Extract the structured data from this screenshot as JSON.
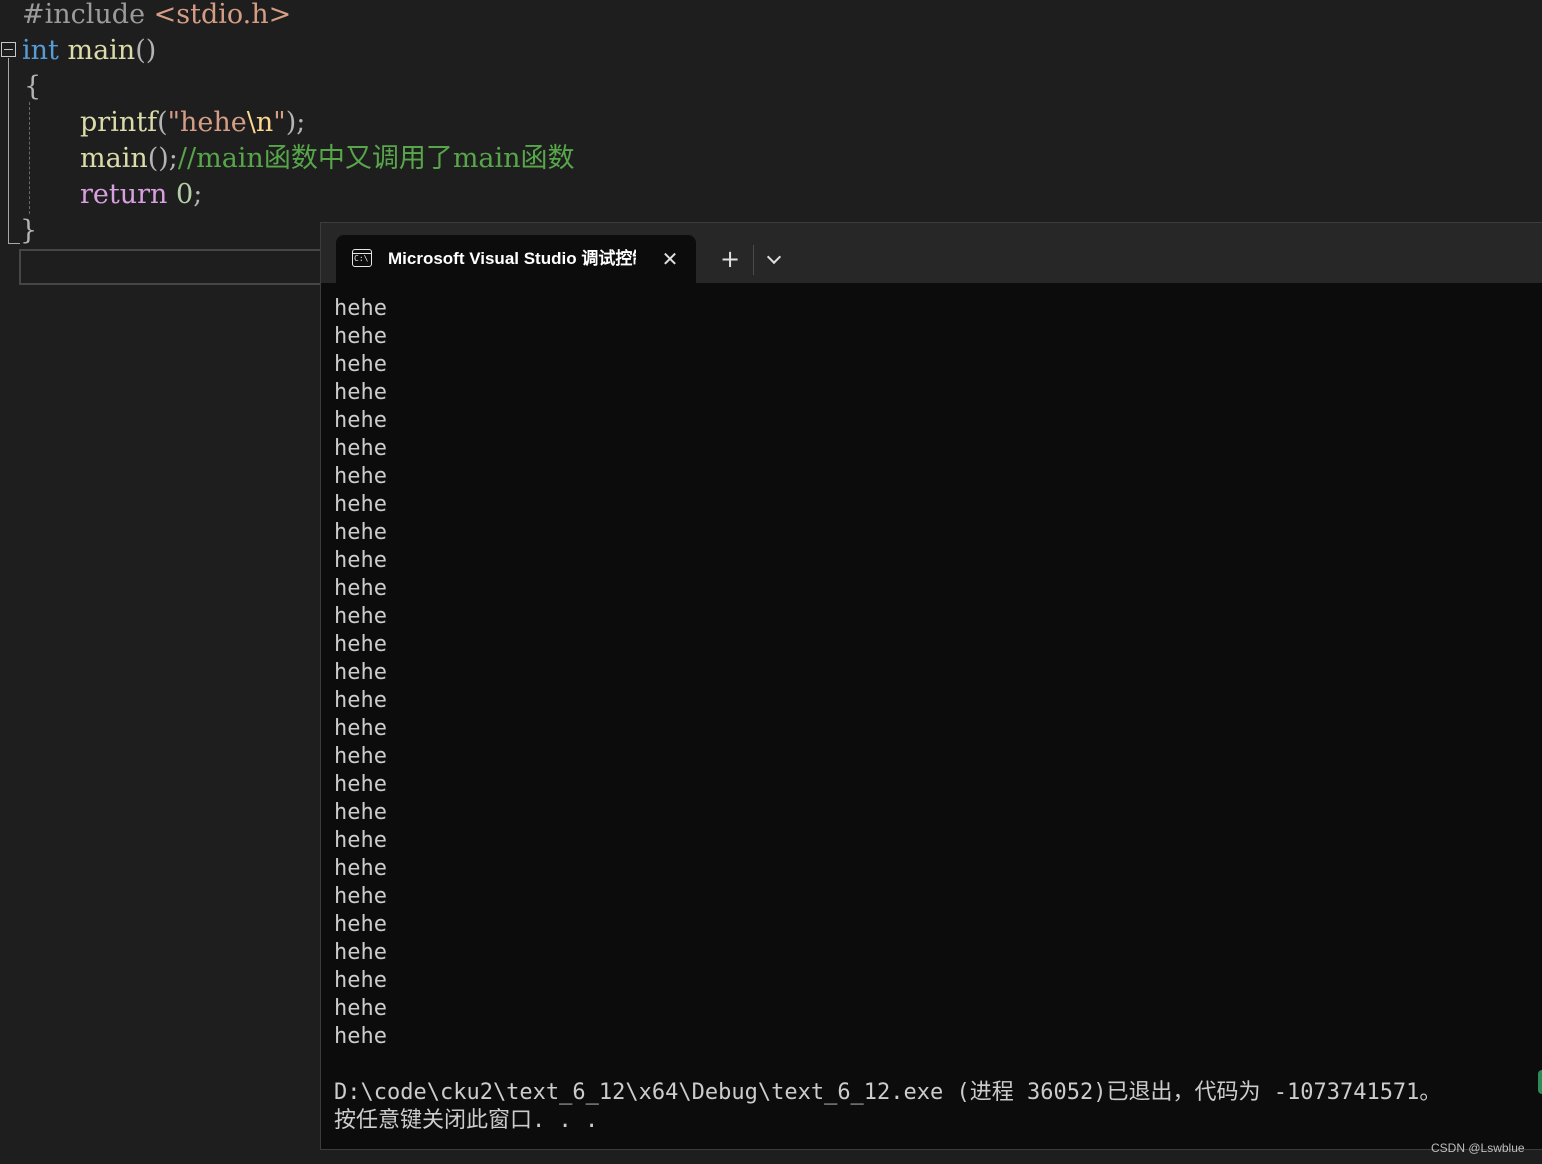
{
  "editor": {
    "line_include": {
      "directive": "#include",
      "header": "<stdio.h>"
    },
    "line_main_decl": {
      "keyword": "int",
      "name": "main",
      "parens": "()"
    },
    "line_open_brace": "{",
    "line_printf": {
      "fn": "printf",
      "open": "(",
      "string": "\"hehe",
      "escape": "\\n",
      "string_end": "\"",
      "close": ");"
    },
    "line_main_call": {
      "fn": "main",
      "rest": "();",
      "comment": "//main函数中又调用了main函数"
    },
    "line_return": {
      "keyword": "return",
      "value": "0",
      "semicolon": ";"
    },
    "line_close_brace": "}"
  },
  "terminal": {
    "tab_title": "Microsoft Visual Studio 调试控制台",
    "tab_icon_text": "C:\\",
    "new_tab_label": "+",
    "close_label": "✕",
    "output_lines": [
      "hehe",
      "hehe",
      "hehe",
      "hehe",
      "hehe",
      "hehe",
      "hehe",
      "hehe",
      "hehe",
      "hehe",
      "hehe",
      "hehe",
      "hehe",
      "hehe",
      "hehe",
      "hehe",
      "hehe",
      "hehe",
      "hehe",
      "hehe",
      "hehe",
      "hehe",
      "hehe",
      "hehe",
      "hehe",
      "hehe",
      "hehe"
    ],
    "exit_message": "D:\\code\\cku2\\text_6_12\\x64\\Debug\\text_6_12.exe (进程 36052)已退出，代码为 -1073741571。",
    "close_prompt": "按任意键关闭此窗口. . ."
  },
  "watermark": "CSDN @Lswblue",
  "colors": {
    "editor_bg": "#1e1e1e",
    "terminal_bg": "#0c0c0c",
    "keyword": "#569cd6",
    "function": "#dcdcaa",
    "string": "#d69d85",
    "comment": "#57a64a",
    "control_keyword": "#d8a0df"
  }
}
